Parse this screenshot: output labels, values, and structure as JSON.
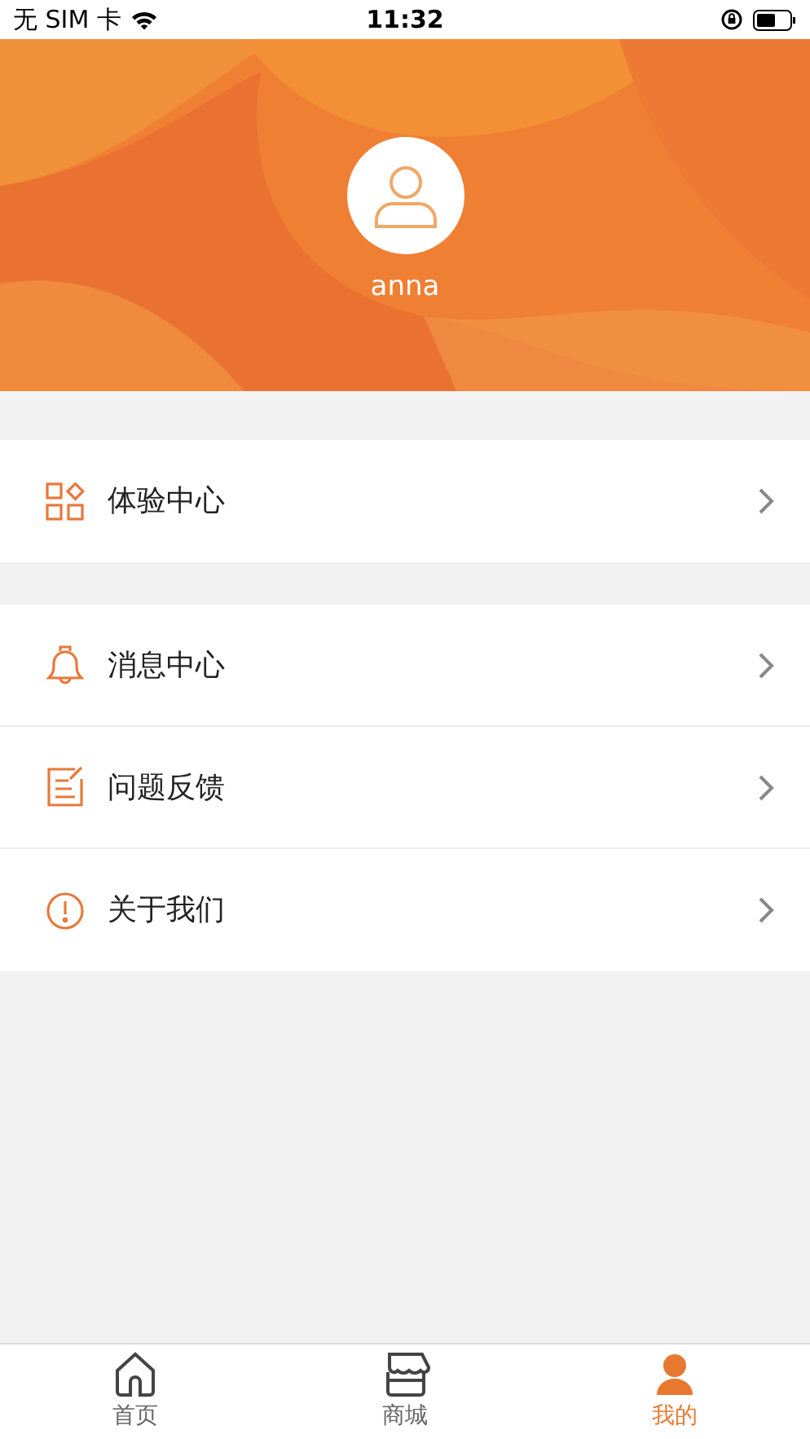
{
  "status_bar": {
    "carrier": "无 SIM 卡",
    "time": "11:32"
  },
  "profile": {
    "username": "anna"
  },
  "menu_groups": [
    [
      {
        "label": "体验中心"
      }
    ],
    [
      {
        "label": "消息中心"
      },
      {
        "label": "问题反馈"
      },
      {
        "label": "关于我们"
      }
    ]
  ],
  "tab_bar": [
    {
      "label": "首页",
      "selected": false
    },
    {
      "label": "商城",
      "selected": false
    },
    {
      "label": "我的",
      "selected": true
    }
  ]
}
